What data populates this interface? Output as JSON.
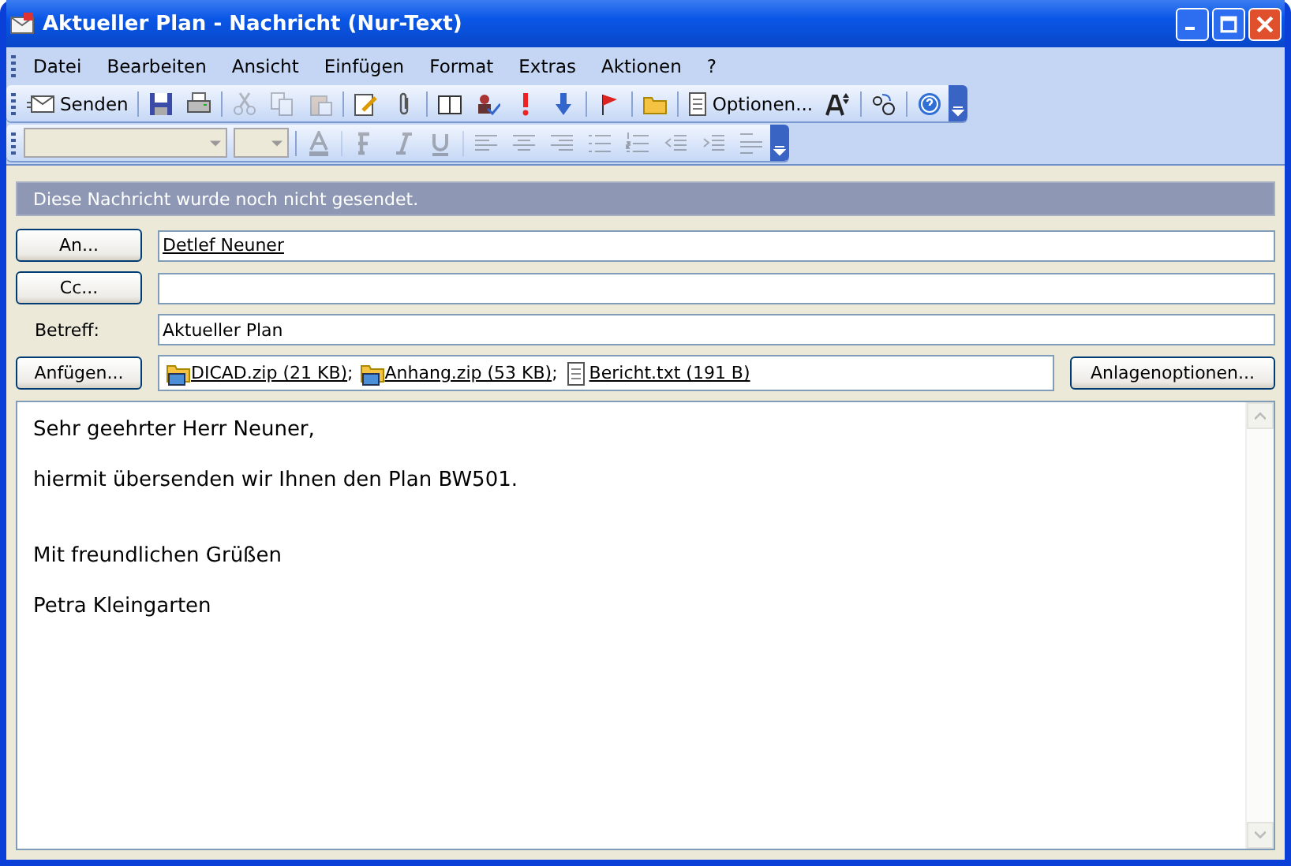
{
  "window": {
    "title": "Aktueller Plan - Nachricht (Nur-Text)"
  },
  "menu": [
    "Datei",
    "Bearbeiten",
    "Ansicht",
    "Einfügen",
    "Format",
    "Extras",
    "Aktionen",
    "?"
  ],
  "toolbar": {
    "send_label": "Senden",
    "options_label": "Optionen...",
    "clipboard_disabled": true
  },
  "format_toolbar": {
    "disabled": true
  },
  "info_bar": "Diese Nachricht wurde noch nicht gesendet.",
  "to": {
    "button": "An...",
    "value": "Detlef Neuner"
  },
  "cc": {
    "button": "Cc..."
  },
  "subject": {
    "label": "Betreff:",
    "value": "Aktueller Plan"
  },
  "attach": {
    "button": "Anfügen...",
    "options_button": "Anlagenoptionen...",
    "files": [
      {
        "name": "DICAD.zip (21 KB)",
        "kind": "zip",
        "separator": ";"
      },
      {
        "name": "Anhang.zip (53 KB)",
        "kind": "zip",
        "separator": ";"
      },
      {
        "name": "Bericht.txt (191 B)",
        "kind": "text"
      }
    ]
  },
  "body": [
    {
      "lines": [
        "Sehr geehrter Herr Neuner,",
        "hiermit übersenden wir Ihnen den Plan BW501."
      ]
    },
    {
      "lines": [
        "Mit freundlichen Grüßen",
        "Petra Kleingarten"
      ]
    }
  ]
}
